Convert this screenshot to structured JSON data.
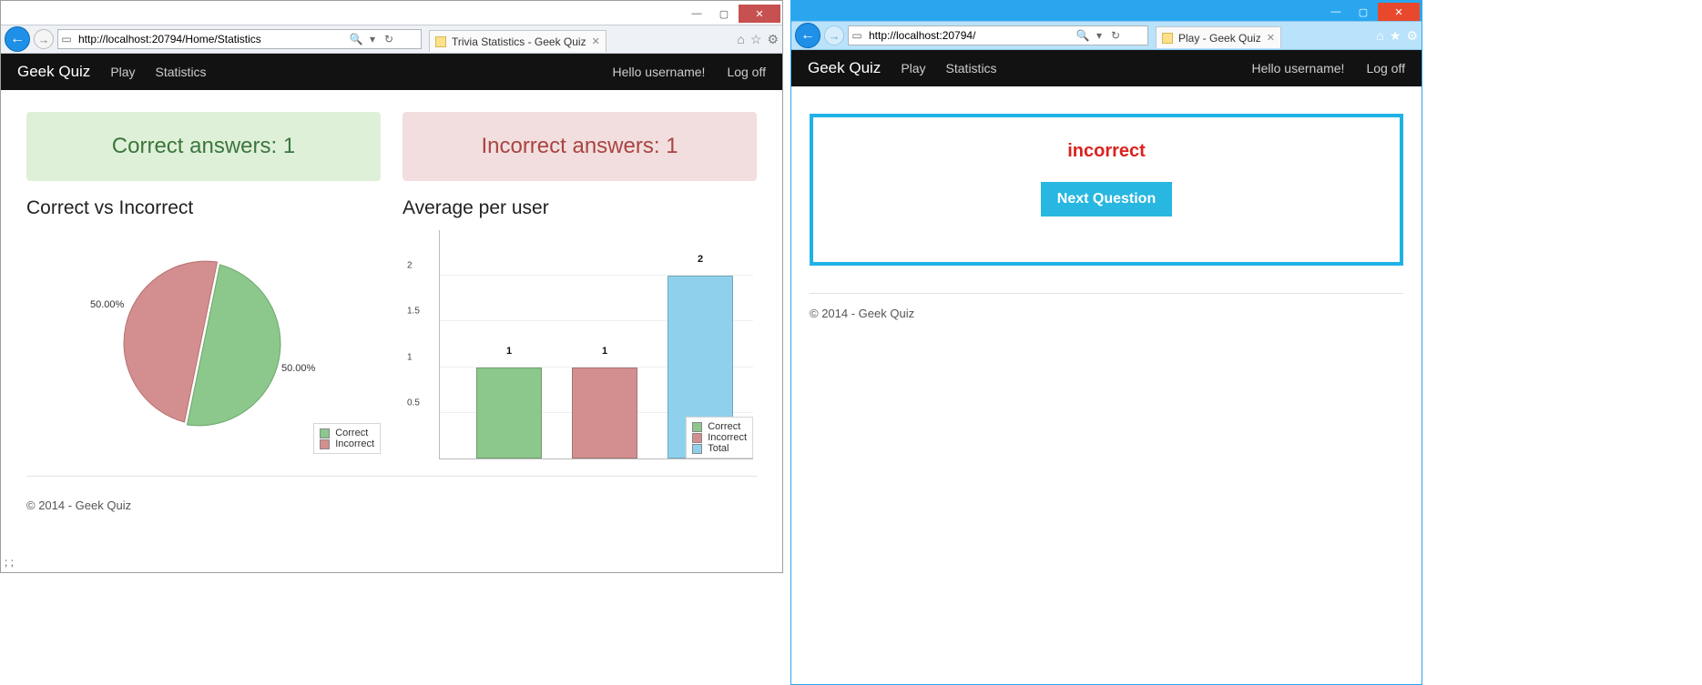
{
  "left": {
    "title_controls": {
      "min": "—",
      "max": "▢",
      "close": "✕"
    },
    "url": "http://localhost:20794/Home/Statistics",
    "search_placeholder": "",
    "search_icon_label": "🔍",
    "refresh_icon_label": "↻",
    "tab_title": "Trivia Statistics - Geek Quiz",
    "toolbar_icons": {
      "home": "⌂",
      "star": "☆",
      "gear": "⚙"
    },
    "brand": "Geek Quiz",
    "nav": {
      "play": "Play",
      "stats": "Statistics"
    },
    "user": {
      "hello": "Hello username!",
      "logoff": "Log off"
    },
    "alerts": {
      "correct_label": "Correct answers: 1",
      "incorrect_label": "Incorrect answers: 1"
    },
    "sections": {
      "pie_title": "Correct vs Incorrect",
      "bar_title": "Average per user"
    },
    "footer": "© 2014 - Geek Quiz",
    "stray": "; ;"
  },
  "right": {
    "title_controls": {
      "min": "—",
      "max": "▢",
      "close": "✕"
    },
    "url": "http://localhost:20794/",
    "tab_title": "Play - Geek Quiz",
    "toolbar_icons": {
      "home": "⌂",
      "star": "★",
      "gear": "⚙"
    },
    "brand": "Geek Quiz",
    "nav": {
      "play": "Play",
      "stats": "Statistics"
    },
    "user": {
      "hello": "Hello username!",
      "logoff": "Log off"
    },
    "result": "incorrect",
    "result_color": "#d9231f",
    "next_btn": "Next Question",
    "footer": "© 2014 - Geek Quiz"
  },
  "colors": {
    "green": "#8cc78c",
    "red": "#d38f8f",
    "blue": "#8fd1ec"
  },
  "chart_data": [
    {
      "type": "pie",
      "title": "Correct vs Incorrect",
      "series": [
        {
          "name": "Correct",
          "value": 50.0,
          "label": "50.00%",
          "color": "#8cc78c"
        },
        {
          "name": "Incorrect",
          "value": 50.0,
          "label": "50.00%",
          "color": "#d38f8f"
        }
      ],
      "legend": [
        "Correct",
        "Incorrect"
      ]
    },
    {
      "type": "bar",
      "title": "Average per user",
      "categories": [
        "Correct",
        "Incorrect",
        "Total"
      ],
      "values": [
        1,
        1,
        2
      ],
      "colors": [
        "#8cc78c",
        "#d38f8f",
        "#8fd1ec"
      ],
      "ylim": [
        0,
        2.5
      ],
      "yticks": [
        0.5,
        1.0,
        1.5,
        2.0
      ],
      "legend": [
        "Correct",
        "Incorrect",
        "Total"
      ]
    }
  ]
}
